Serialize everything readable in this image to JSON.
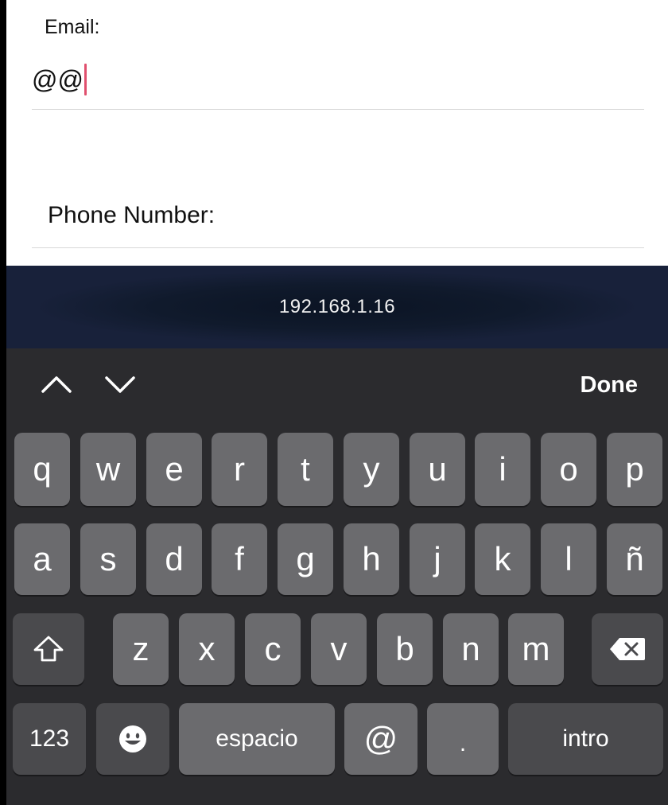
{
  "form": {
    "email_label": "Email:",
    "email_value": "@@",
    "phone_label": "Phone Number:"
  },
  "address_bar": {
    "text": "192.168.1.16"
  },
  "accessory": {
    "done_label": "Done",
    "up_icon": "chevron-up-icon",
    "down_icon": "chevron-down-icon"
  },
  "keyboard": {
    "row1": [
      "q",
      "w",
      "e",
      "r",
      "t",
      "y",
      "u",
      "i",
      "o",
      "p"
    ],
    "row2": [
      "a",
      "s",
      "d",
      "f",
      "g",
      "h",
      "j",
      "k",
      "l",
      "ñ"
    ],
    "row3": [
      "z",
      "x",
      "c",
      "v",
      "b",
      "n",
      "m"
    ],
    "numbers_label": "123",
    "space_label": "espacio",
    "at_label": "@",
    "dot_label": ".",
    "return_label": "intro",
    "shift_icon": "shift-icon",
    "delete_icon": "delete-icon",
    "emoji_icon": "emoji-icon"
  },
  "colors": {
    "caret": "#e0506e",
    "key": "#6b6b6e",
    "key_dark": "#4a4a4d",
    "keyboard_bg": "#2b2b2e"
  }
}
